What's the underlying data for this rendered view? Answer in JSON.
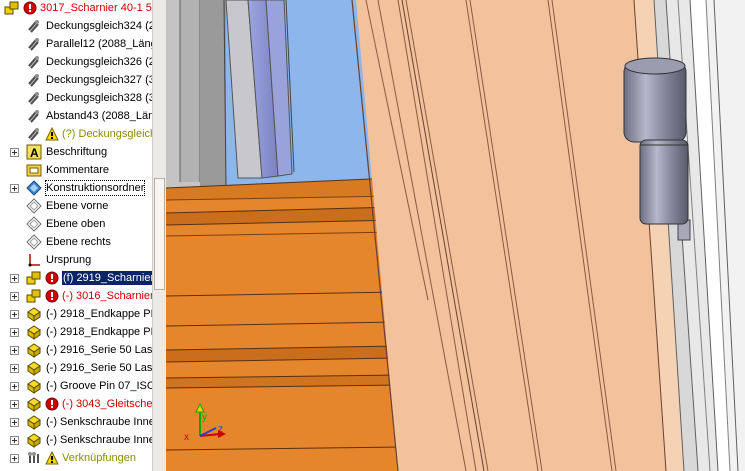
{
  "tree": {
    "items": [
      {
        "label": "3017_Scharnier 40-1 5",
        "color": "red",
        "icon": "assembly-icon",
        "status": "error"
      },
      {
        "label": "Deckungsgleich324 (2",
        "icon": "mate-icon"
      },
      {
        "label": "Parallel12 (2088_Läng",
        "icon": "mate-icon"
      },
      {
        "label": "Deckungsgleich326 (2",
        "icon": "mate-icon"
      },
      {
        "label": "Deckungsgleich327 (3",
        "icon": "mate-icon"
      },
      {
        "label": "Deckungsgleich328 (3",
        "icon": "mate-icon"
      },
      {
        "label": "Abstand43 (2088_Läng",
        "icon": "mate-icon"
      },
      {
        "label": "(?) Deckungsgleich",
        "color": "olive",
        "icon": "mate-icon",
        "status": "warning"
      },
      {
        "label": "Beschriftung",
        "icon": "annotation-icon",
        "expand": true
      },
      {
        "label": "Kommentare",
        "icon": "comments-folder-icon"
      },
      {
        "label": "Konstruktionsordner",
        "icon": "design-binder-icon",
        "expand": true,
        "framed": true
      },
      {
        "label": "Ebene vorne",
        "icon": "plane-icon"
      },
      {
        "label": "Ebene oben",
        "icon": "plane-icon"
      },
      {
        "label": "Ebene rechts",
        "icon": "plane-icon"
      },
      {
        "label": "Ursprung",
        "icon": "origin-icon"
      },
      {
        "label": "(f) 2919_Scharnier",
        "icon": "assembly-icon",
        "status": "error",
        "expand": true,
        "selected": true
      },
      {
        "label": "(-) 3016_Scharnier",
        "color": "red",
        "icon": "assembly-icon",
        "status": "error",
        "expand": true
      },
      {
        "label": "(-) 2918_Endkappe PE",
        "icon": "part-icon",
        "expand": true
      },
      {
        "label": "(-) 2918_Endkappe PE",
        "icon": "part-icon",
        "expand": true
      },
      {
        "label": "(-) 2916_Serie 50 Las",
        "icon": "part-icon",
        "expand": true
      },
      {
        "label": "(-) 2916_Serie 50 Las",
        "icon": "part-icon",
        "expand": true
      },
      {
        "label": "(-) Groove Pin 07_ISC",
        "icon": "part-icon",
        "expand": true
      },
      {
        "label": "(-) 3043_Gleitsche",
        "color": "red",
        "icon": "part-icon",
        "status": "error",
        "expand": true
      },
      {
        "label": "(-) Senkschraube Inne",
        "icon": "part-icon",
        "expand": true
      },
      {
        "label": "(-) Senkschraube Inne",
        "icon": "part-icon",
        "expand": true
      },
      {
        "label": "Verknüpfungen",
        "color": "olive",
        "icon": "mates-folder-icon",
        "status": "warning",
        "expand": true
      }
    ]
  },
  "viewport": {
    "triad": {
      "x_label": "x",
      "y_label": "y",
      "z_label": "z"
    },
    "colors": {
      "sky": "#8cb6ec",
      "orange": "#e6862c",
      "wood": "#f2c29c",
      "hinge": "#8a8aa0",
      "frame": "#cfcfcf"
    }
  }
}
